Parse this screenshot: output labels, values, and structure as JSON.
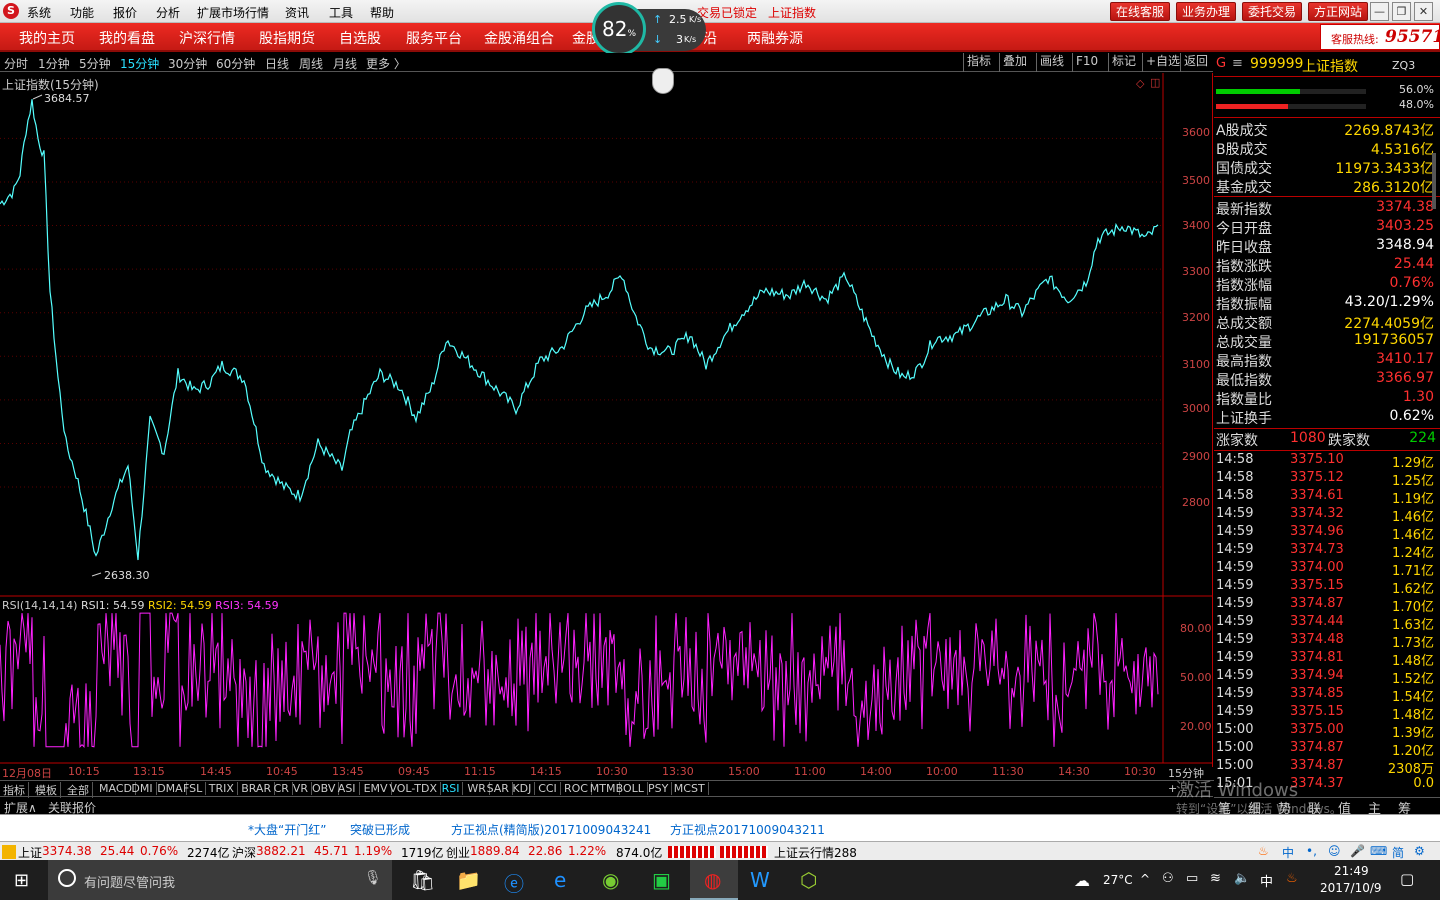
{
  "menu": {
    "logo": "S",
    "items": [
      "系统",
      "功能",
      "报价",
      "分析",
      "扩展市场行情",
      "资讯",
      "工具",
      "帮助"
    ],
    "lock_text": "交易已锁定",
    "index_name": "上证指数"
  },
  "top_buttons": [
    "在线客服",
    "业务办理",
    "委托交易",
    "方正网站"
  ],
  "window_buttons": [
    "—",
    "❐",
    "✕"
  ],
  "network": {
    "percent": "82",
    "unit": "%",
    "up": "2.5",
    "up_unit": "K/s",
    "down": "3",
    "down_unit": "K/s"
  },
  "nav": [
    "我的主页",
    "我的看盘",
    "沪深行情",
    "股指期货",
    "自选股",
    "服务平台",
    "金股涌组合",
    "金股",
    "万",
    "沿",
    "两融券源"
  ],
  "hotline": {
    "label": "客服热线:",
    "number": "95571"
  },
  "periods": [
    "分时",
    "1分钟",
    "5分钟",
    "15分钟",
    "30分钟",
    "60分钟",
    "日线",
    "周线",
    "月线",
    "更多 〉"
  ],
  "active_period": "15分钟",
  "toolbar_right": [
    "指标",
    "叠加",
    "画线",
    "F10",
    "标记",
    "+自选",
    "返回"
  ],
  "chart_title": "上证指数(15分钟)",
  "high_label": "3684.57",
  "low_label": "2638.30",
  "yaxis": [
    "3600",
    "3500",
    "3400",
    "3300",
    "3200",
    "3100",
    "3000",
    "2900",
    "2800"
  ],
  "rsi_axis": [
    "80.00",
    "50.00",
    "20.00"
  ],
  "rsi": {
    "label": "RSI(14,14,14)",
    "rsi1_label": "RSI1:",
    "rsi1": "54.59",
    "rsi2_label": "RSI2:",
    "rsi2": "54.59",
    "rsi3_label": "RSI3:",
    "rsi3": "54.59"
  },
  "xaxis": [
    "12月08日",
    "10:15",
    "13:15",
    "14:45",
    "10:45",
    "13:45",
    "09:45",
    "11:15",
    "14:15",
    "10:30",
    "13:30",
    "15:00",
    "11:00",
    "14:00",
    "10:00",
    "11:30",
    "14:30",
    "10:30"
  ],
  "period_right": "15分钟",
  "indicator_tabs": [
    "指标",
    "模板",
    "全部",
    "MACD",
    "DMI",
    "DMA",
    "FSL",
    "TRIX",
    "BRAR",
    "CR",
    "VR",
    "OBV",
    "ASI",
    "EMV",
    "VOL-TDX",
    "RSI",
    "WR",
    "SAR",
    "KDJ",
    "CCI",
    "ROC",
    "MTM",
    "BOLL",
    "PSY",
    "MCST"
  ],
  "active_indicator": "RSI",
  "bottom_left": [
    "扩展∧",
    "关联报价"
  ],
  "right_bottom_tabs": [
    "笔",
    "细",
    "势",
    "联",
    "值",
    "主",
    "筹"
  ],
  "ticker": [
    "*大盘“开门红”",
    "突破已形成",
    "方正视点(精简版)20171009043241",
    "方正视点20171009043211"
  ],
  "status": {
    "sh_label": "上证",
    "sh_val": "3374.38",
    "sh_chg": "25.44",
    "sh_pct": "0.76%",
    "sh_amt": "2274亿",
    "sz_label": "沪深",
    "sz_val": "3882.21",
    "sz_chg": "45.71",
    "sz_pct": "1.19%",
    "sz_amt": "1719亿",
    "cy_label": "创业",
    "cy_val": "1889.84",
    "cy_chg": "22.86",
    "cy_pct": "1.22%",
    "cy_amt": "874.0亿",
    "cloud": "上证云行情288"
  },
  "taskbar": {
    "search": "有问题尽管问我",
    "temp": "27°C",
    "ime": "中",
    "time": "21:49",
    "date": "2017/10/9"
  },
  "watermark": {
    "line1": "激活 Windows",
    "line2": "转到“设置”以激活 Windows。"
  },
  "quote": {
    "code": "999999",
    "name": "上证指数",
    "zq": "ZQ3",
    "buy_ratio": "56.0%",
    "sell_ratio": "48.0%",
    "buy_fill": 0.56,
    "sell_fill": 0.48
  },
  "volumes": [
    {
      "l": "A股成交",
      "v": "2269.8743亿"
    },
    {
      "l": "B股成交",
      "v": "4.5316亿"
    },
    {
      "l": "国债成交",
      "v": "11973.3433亿"
    },
    {
      "l": "基金成交",
      "v": "286.3120亿"
    }
  ],
  "stats": [
    {
      "l": "最新指数",
      "v": "3374.38",
      "c": "#ff3030"
    },
    {
      "l": "今日开盘",
      "v": "3403.25",
      "c": "#ff3030"
    },
    {
      "l": "昨日收盘",
      "v": "3348.94",
      "c": "#ffffff"
    },
    {
      "l": "指数涨跌",
      "v": "25.44",
      "c": "#ff3030"
    },
    {
      "l": "指数涨幅",
      "v": "0.76%",
      "c": "#ff3030"
    },
    {
      "l": "指数振幅",
      "v": "43.20/1.29%",
      "c": "#ffffff"
    },
    {
      "l": "总成交额",
      "v": "2274.4059亿",
      "c": "#ffd700"
    },
    {
      "l": "总成交量",
      "v": "191736057",
      "c": "#ffd700"
    },
    {
      "l": "最高指数",
      "v": "3410.17",
      "c": "#ff3030"
    },
    {
      "l": "最低指数",
      "v": "3366.97",
      "c": "#ff3030"
    },
    {
      "l": "指数量比",
      "v": "1.30",
      "c": "#ff3030"
    },
    {
      "l": "上证换手",
      "v": "0.62%",
      "c": "#ffffff"
    }
  ],
  "updown": {
    "up_label": "涨家数",
    "up": "1080",
    "down_label": "跌家数",
    "down": "224"
  },
  "trades": [
    {
      "t": "14:58",
      "p": "3375.10",
      "v": "1.29亿"
    },
    {
      "t": "14:58",
      "p": "3375.12",
      "v": "1.25亿"
    },
    {
      "t": "14:58",
      "p": "3374.61",
      "v": "1.19亿"
    },
    {
      "t": "14:59",
      "p": "3374.32",
      "v": "1.46亿"
    },
    {
      "t": "14:59",
      "p": "3374.96",
      "v": "1.46亿"
    },
    {
      "t": "14:59",
      "p": "3374.73",
      "v": "1.24亿"
    },
    {
      "t": "14:59",
      "p": "3374.00",
      "v": "1.71亿"
    },
    {
      "t": "14:59",
      "p": "3375.15",
      "v": "1.62亿"
    },
    {
      "t": "14:59",
      "p": "3374.87",
      "v": "1.70亿"
    },
    {
      "t": "14:59",
      "p": "3374.44",
      "v": "1.63亿"
    },
    {
      "t": "14:59",
      "p": "3374.48",
      "v": "1.73亿"
    },
    {
      "t": "14:59",
      "p": "3374.81",
      "v": "1.48亿"
    },
    {
      "t": "14:59",
      "p": "3374.94",
      "v": "1.52亿"
    },
    {
      "t": "14:59",
      "p": "3374.85",
      "v": "1.54亿"
    },
    {
      "t": "14:59",
      "p": "3375.15",
      "v": "1.48亿"
    },
    {
      "t": "15:00",
      "p": "3375.00",
      "v": "1.39亿"
    },
    {
      "t": "15:00",
      "p": "3374.87",
      "v": "1.20亿"
    },
    {
      "t": "15:00",
      "p": "3374.87",
      "v": "2308万"
    },
    {
      "t": "15:01",
      "p": "3374.37",
      "v": "0.0"
    }
  ],
  "chart_data": {
    "type": "line",
    "anchors": [
      [
        0,
        3450
      ],
      [
        14,
        3480
      ],
      [
        20,
        3520
      ],
      [
        26,
        3620
      ],
      [
        32,
        3685
      ],
      [
        38,
        3600
      ],
      [
        44,
        3560
      ],
      [
        50,
        3250
      ],
      [
        58,
        3050
      ],
      [
        66,
        2900
      ],
      [
        76,
        2830
      ],
      [
        90,
        2700
      ],
      [
        96,
        2640
      ],
      [
        112,
        2760
      ],
      [
        128,
        2850
      ],
      [
        138,
        2640
      ],
      [
        150,
        2950
      ],
      [
        164,
        2880
      ],
      [
        178,
        3060
      ],
      [
        194,
        3020
      ],
      [
        210,
        3040
      ],
      [
        222,
        3080
      ],
      [
        244,
        3050
      ],
      [
        264,
        2850
      ],
      [
        284,
        2800
      ],
      [
        300,
        2780
      ],
      [
        318,
        2900
      ],
      [
        342,
        2840
      ],
      [
        350,
        2920
      ],
      [
        366,
        3000
      ],
      [
        380,
        3060
      ],
      [
        400,
        3030
      ],
      [
        416,
        2960
      ],
      [
        432,
        3030
      ],
      [
        446,
        3140
      ],
      [
        468,
        3090
      ],
      [
        494,
        3030
      ],
      [
        516,
        2980
      ],
      [
        540,
        3090
      ],
      [
        562,
        3120
      ],
      [
        584,
        3200
      ],
      [
        610,
        3250
      ],
      [
        622,
        3290
      ],
      [
        634,
        3200
      ],
      [
        650,
        3120
      ],
      [
        670,
        3110
      ],
      [
        690,
        3150
      ],
      [
        706,
        3080
      ],
      [
        722,
        3140
      ],
      [
        742,
        3200
      ],
      [
        764,
        3250
      ],
      [
        790,
        3240
      ],
      [
        806,
        3270
      ],
      [
        826,
        3230
      ],
      [
        846,
        3285
      ],
      [
        858,
        3220
      ],
      [
        872,
        3150
      ],
      [
        890,
        3080
      ],
      [
        904,
        3050
      ],
      [
        918,
        3070
      ],
      [
        934,
        3140
      ],
      [
        958,
        3150
      ],
      [
        980,
        3190
      ],
      [
        1006,
        3230
      ],
      [
        1022,
        3200
      ],
      [
        1048,
        3280
      ],
      [
        1068,
        3230
      ],
      [
        1086,
        3270
      ],
      [
        1098,
        3370
      ],
      [
        1124,
        3400
      ],
      [
        1146,
        3370
      ],
      [
        1160,
        3400
      ]
    ]
  }
}
